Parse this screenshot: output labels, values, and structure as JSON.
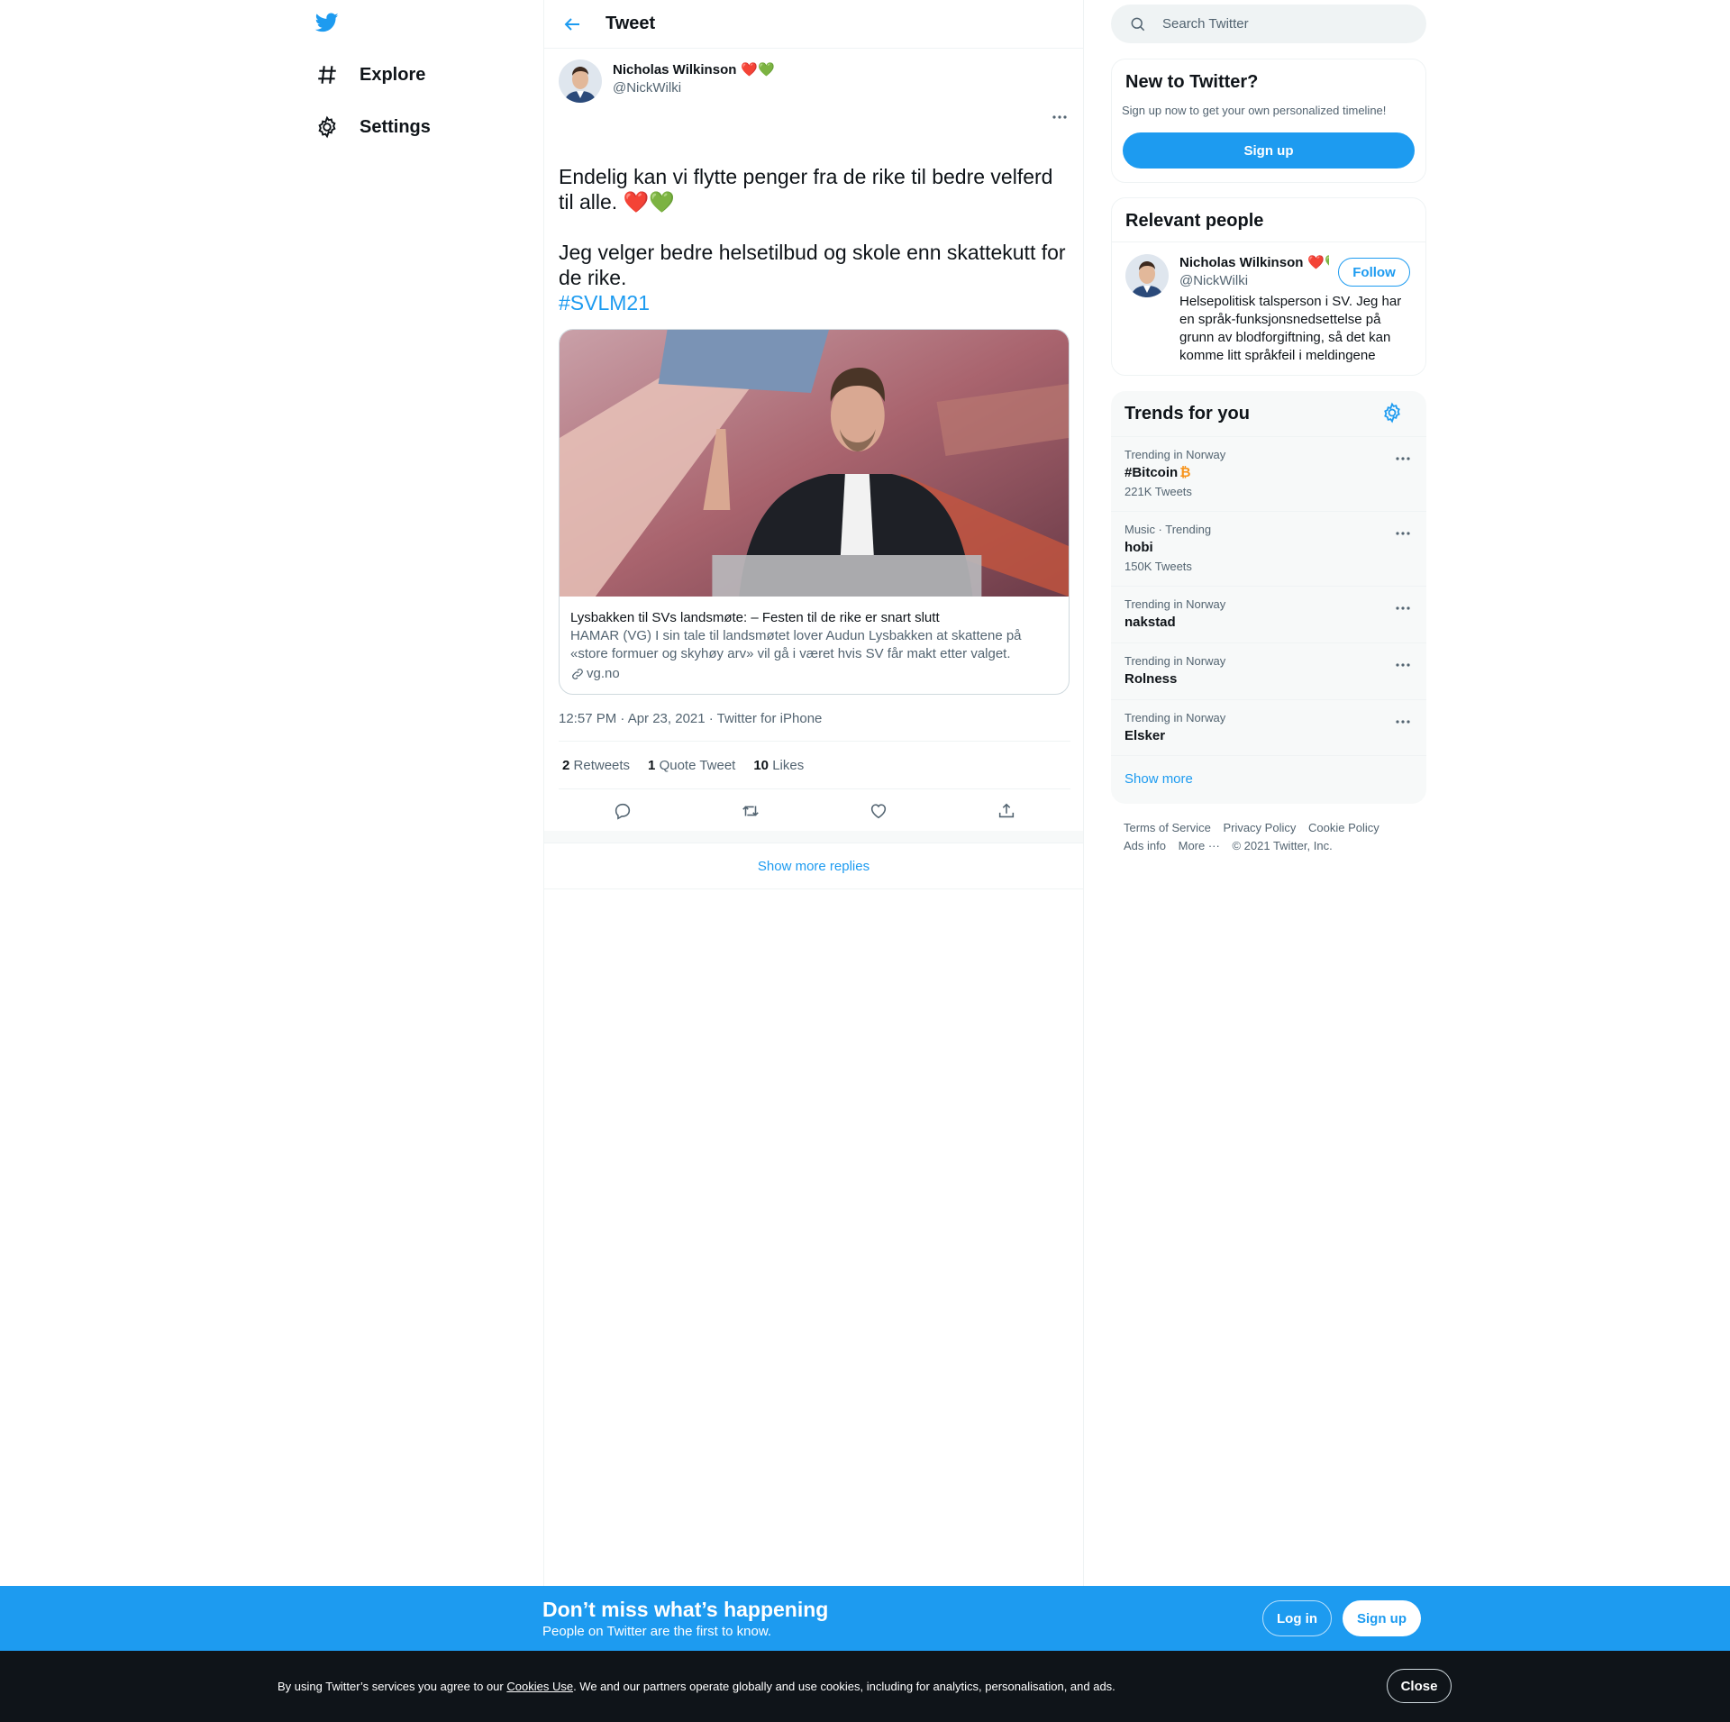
{
  "nav": {
    "logo_icon": "twitter-bird-icon",
    "items": [
      {
        "label": "Explore",
        "icon": "hashtag-icon"
      },
      {
        "label": "Settings",
        "icon": "gear-icon"
      }
    ]
  },
  "header": {
    "title": "Tweet"
  },
  "tweet": {
    "author_name": "Nicholas Wilkinson",
    "author_emoji": "❤️💚",
    "author_handle": "@NickWilki",
    "text_line1": "Endelig kan vi flytte penger fra de rike til bedre velferd til alle.",
    "text_line1_emoji": "❤️💚",
    "text_line2": "Jeg velger bedre helsetilbud og skole enn skattekutt for de rike.",
    "hashtag": "#SVLM21",
    "card": {
      "title": "Lysbakken til SVs landsmøte: – Festen til de rike er snart slutt",
      "description": "HAMAR (VG) I sin tale til landsmøtet lover Audun Lysbakken at skattene på «store formuer og skyhøy arv» vil gå i været hvis SV får makt etter valget.",
      "domain": "vg.no"
    },
    "meta": "12:57 PM · Apr 23, 2021 · Twitter for iPhone",
    "stats": [
      {
        "count": "2",
        "label": "Retweets"
      },
      {
        "count": "1",
        "label": "Quote Tweet"
      },
      {
        "count": "10",
        "label": "Likes"
      }
    ],
    "actions": [
      "reply-icon",
      "retweet-icon",
      "like-icon",
      "share-icon"
    ]
  },
  "show_more_replies": "Show more replies",
  "search": {
    "placeholder": "Search Twitter"
  },
  "new_to_twitter": {
    "title": "New to Twitter?",
    "subtitle": "Sign up now to get your own personalized timeline!",
    "button": "Sign up"
  },
  "relevant_people": {
    "title": "Relevant people",
    "name": "Nicholas Wilkinson",
    "emoji": "❤️💚",
    "handle": "@NickWilki",
    "follow": "Follow",
    "bio": "Helsepolitisk talsperson i SV. Jeg har en språk-funksjonsnedsettelse på grunn av blodforgiftning, så det kan komme litt språkfeil i meldingene"
  },
  "trends": {
    "title": "Trends for you",
    "items": [
      {
        "context": "Trending in Norway",
        "name": "#Bitcoin",
        "badge": "₿",
        "count": "221K Tweets"
      },
      {
        "context": "Music · Trending",
        "name": "hobi",
        "count": "150K Tweets"
      },
      {
        "context": "Trending in Norway",
        "name": "nakstad"
      },
      {
        "context": "Trending in Norway",
        "name": "Rolness"
      },
      {
        "context": "Trending in Norway",
        "name": "Elsker"
      }
    ],
    "show_more": "Show more"
  },
  "footer": {
    "links": [
      "Terms of Service",
      "Privacy Policy",
      "Cookie Policy",
      "Ads info",
      "More ···"
    ],
    "copyright": "© 2021 Twitter, Inc."
  },
  "banner": {
    "headline": "Don’t miss what’s happening",
    "sub": "People on Twitter are the first to know.",
    "login": "Log in",
    "signup": "Sign up"
  },
  "cookie": {
    "prefix": "By using Twitter’s services you agree to our ",
    "link": "Cookies Use",
    "suffix": ". We and our partners operate globally and use cookies, including for analytics, personalisation, and ads.",
    "close": "Close"
  },
  "colors": {
    "accent": "#1d9bf0",
    "text": "#0f1419",
    "secondary": "#536471",
    "heart_red": "#e0245e",
    "heart_green": "#6ab04c",
    "bitcoin": "#f7931a",
    "cookie_bg": "#0f1419"
  }
}
